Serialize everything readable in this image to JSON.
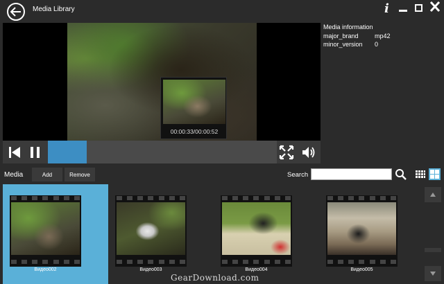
{
  "app": {
    "title": "Media Library"
  },
  "window_controls": {
    "info": "i"
  },
  "media_info": {
    "title": "Media information",
    "rows": [
      {
        "key": "major_brand",
        "value": "mp42"
      },
      {
        "key": "minor_version",
        "value": "0"
      }
    ]
  },
  "player": {
    "preview_time": "00:00:33/00:00:52",
    "progress_fraction": 0.17
  },
  "toolbar": {
    "media_label": "Media",
    "add_label": "Add",
    "remove_label": "Remove",
    "search_label": "Search",
    "search_value": ""
  },
  "gallery": {
    "items": [
      {
        "name": "Видео002",
        "selected": true
      },
      {
        "name": "Видео003",
        "selected": false
      },
      {
        "name": "Видео004",
        "selected": false
      },
      {
        "name": "Видео005",
        "selected": false
      }
    ]
  },
  "watermark": "GearDownload.com",
  "colors": {
    "accent": "#3d8ec3",
    "selected": "#5ab0d8",
    "background": "#2b2b2b"
  }
}
